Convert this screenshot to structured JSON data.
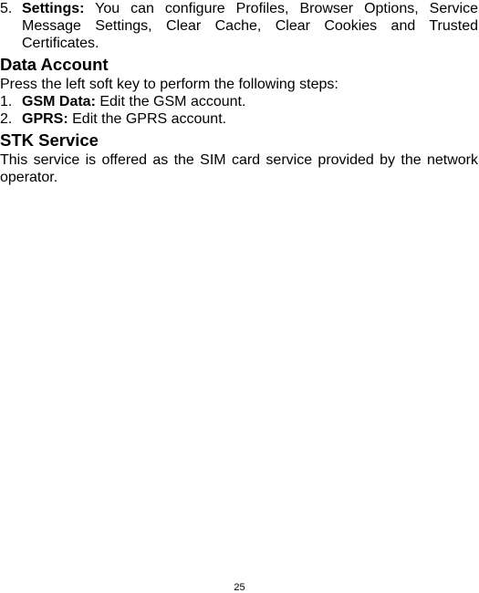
{
  "document": {
    "settings_item": {
      "number": "5.",
      "label": "Settings:",
      "text": " You can configure Profiles, Browser Options, Service Message Settings, Clear Cache, Clear Cookies and Trusted Certificates."
    },
    "data_account": {
      "heading": "Data Account",
      "intro": "Press the left soft key to perform the following steps:",
      "steps": [
        {
          "number": "1.",
          "label": "GSM Data:",
          "text": " Edit the GSM account."
        },
        {
          "number": "2.",
          "label": "GPRS:",
          "text": " Edit the GPRS account."
        }
      ]
    },
    "stk_service": {
      "heading": "STK Service",
      "text": "This service is offered as the SIM card service provided by the network operator."
    }
  },
  "footer": {
    "page_number": "25"
  }
}
